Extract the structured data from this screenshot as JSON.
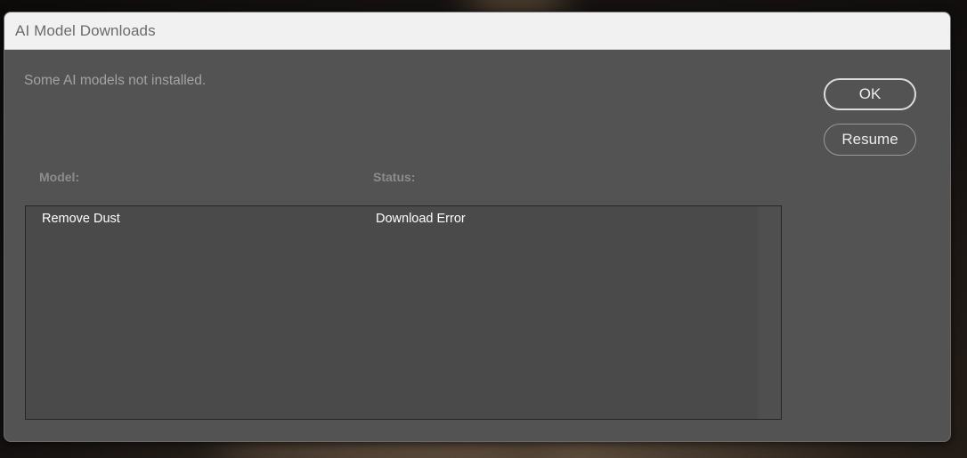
{
  "dialog": {
    "title": "AI Model Downloads",
    "message": "Some AI models not installed."
  },
  "buttons": {
    "ok_label": "OK",
    "resume_label": "Resume"
  },
  "table": {
    "columns": [
      "Model:",
      "Status:"
    ],
    "rows": [
      {
        "model": "Remove Dust",
        "status": "Download Error"
      }
    ]
  },
  "colors": {
    "dialog_bg": "#535353",
    "titlebar_bg": "#f1f1f1",
    "list_bg": "#4a4a4a"
  }
}
